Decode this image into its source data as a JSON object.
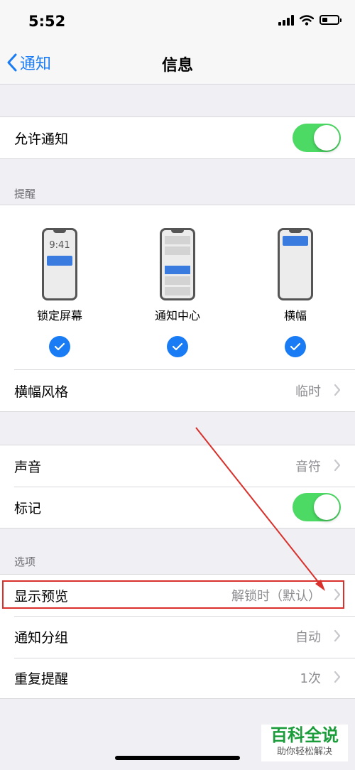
{
  "status_bar": {
    "time": "5:52"
  },
  "nav": {
    "back_label": "通知",
    "title": "信息"
  },
  "allow": {
    "label": "允许通知",
    "on": true
  },
  "alerts": {
    "header": "提醒",
    "lock_screen": {
      "label": "锁定屏幕",
      "preview_time": "9:41",
      "checked": true
    },
    "notification_center": {
      "label": "通知中心",
      "checked": true
    },
    "banners": {
      "label": "横幅",
      "checked": true
    },
    "banner_style": {
      "label": "横幅风格",
      "value": "临时"
    }
  },
  "sounds": {
    "label": "声音",
    "value": "音符"
  },
  "badges": {
    "label": "标记",
    "on": true
  },
  "options": {
    "header": "选项",
    "show_previews": {
      "label": "显示预览",
      "value": "解锁时（默认）"
    },
    "grouping": {
      "label": "通知分组",
      "value": "自动"
    },
    "repeat": {
      "label": "重复提醒",
      "value": "1次"
    }
  },
  "watermark": {
    "title": "百科全说",
    "subtitle": "助你轻松解决"
  },
  "colors": {
    "accent": "#1a7cf5",
    "toggle_on": "#4cd964",
    "highlight": "#d9302b"
  }
}
